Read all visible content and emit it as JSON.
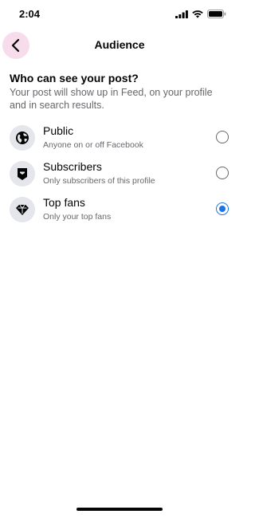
{
  "status_bar": {
    "time": "2:04"
  },
  "header": {
    "title": "Audience"
  },
  "intro": {
    "question": "Who can see your post?",
    "description": "Your post will show up in Feed, on your profile and in search results."
  },
  "options": [
    {
      "title": "Public",
      "subtitle": "Anyone on or off Facebook",
      "icon": "globe-icon",
      "selected": false
    },
    {
      "title": "Subscribers",
      "subtitle": "Only subscribers of this profile",
      "icon": "subscribers-badge-icon",
      "selected": false
    },
    {
      "title": "Top fans",
      "subtitle": "Only your top fans",
      "icon": "diamond-icon",
      "selected": true
    }
  ],
  "colors": {
    "accent": "#1b74e4",
    "back_highlight": "#f7dcec",
    "secondary_text": "#65676b",
    "icon_bg": "#e4e6eb"
  }
}
